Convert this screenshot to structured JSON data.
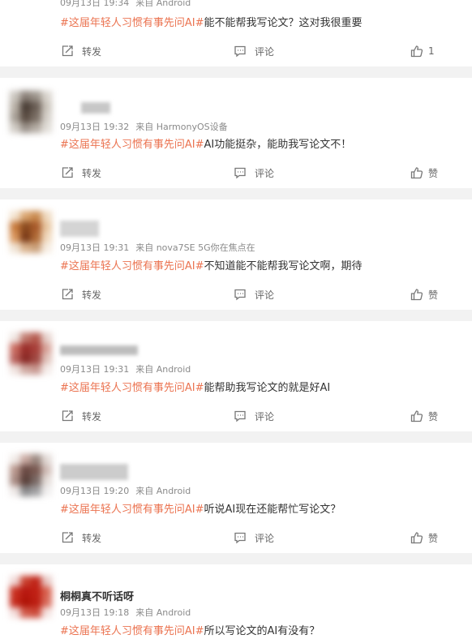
{
  "posts": [
    {
      "meta_time": "09月13日 19:34",
      "meta_source": "来自 Android",
      "topic": "#这届年轻人习惯有事先问AI#",
      "content": "能不能帮我写论文？这对我很重要",
      "repost_label": "转发",
      "comment_label": "评论",
      "like_label": "1",
      "avatar_colors": [
        "#ffffff"
      ],
      "username_blur_color": "#d0d0d0"
    },
    {
      "meta_time": "09月13日 19:32",
      "meta_source": "来自 HarmonyOS设备",
      "topic": "#这届年轻人习惯有事先问AI#",
      "content": "AI功能挺杂，能助我写论文不！",
      "repost_label": "转发",
      "comment_label": "评论",
      "like_label": "赞",
      "avatar_colors": [
        "#c9c4bd",
        "#8a8078",
        "#9c948b",
        "#d8d3cc",
        "#b8b0a6",
        "#4a3e36",
        "#6a5e55",
        "#cbc5bc",
        "#a8a097",
        "#5a4c42",
        "#7a6e64",
        "#d4cfc8",
        "#cfcac3",
        "#9a9189",
        "#b2aaa1",
        "#e0dcd6"
      ],
      "username_blur_color": "#c7c7c7"
    },
    {
      "meta_time": "09月13日 19:31",
      "meta_source": "来自 nova7SE 5G你在焦点在",
      "topic": "#这届年轻人习惯有事先问AI#",
      "content": "不知道能不能帮我写论文啊，期待",
      "repost_label": "转发",
      "comment_label": "评论",
      "like_label": "赞",
      "avatar_colors": [
        "#f3e3cf",
        "#d9a46e",
        "#c98a4e",
        "#efd9bf",
        "#c77a3c",
        "#8a4a1e",
        "#a85a2a",
        "#e8c6a0",
        "#d8955a",
        "#7a3a18",
        "#b06a36",
        "#f0d8bc",
        "#efe2d2",
        "#d8b08a",
        "#caa07a",
        "#f6ece0"
      ],
      "username_blur_color": "#d4d4d4"
    },
    {
      "meta_time": "09月13日 19:31",
      "meta_source": "来自 Android",
      "topic": "#这届年轻人习惯有事先问AI#",
      "content": "能帮助我写论文的就是好AI",
      "repost_label": "转发",
      "comment_label": "评论",
      "like_label": "赞",
      "avatar_colors": [
        "#efe6e2",
        "#c07a6e",
        "#b55a4e",
        "#e6d2cc",
        "#c86a5e",
        "#9a2e2a",
        "#a8403a",
        "#d8a49a",
        "#b8605a",
        "#8a2a26",
        "#a04842",
        "#e0c2ba",
        "#efe2de",
        "#cfa8a0",
        "#c89890",
        "#f4ebe8"
      ],
      "username_blur_color": "#bdbdbd"
    },
    {
      "meta_time": "09月13日 19:20",
      "meta_source": "来自 Android",
      "topic": "#这届年轻人习惯有事先问AI#",
      "content": "听说AI现在还能帮忙写论文？",
      "repost_label": "转发",
      "comment_label": "评论",
      "like_label": "赞",
      "avatar_colors": [
        "#f1ebe8",
        "#c8a8a0",
        "#9a8880",
        "#e2dad6",
        "#b8968c",
        "#6a4a44",
        "#7a5a52",
        "#d0bcb6",
        "#a88a82",
        "#5a403a",
        "#7a6a66",
        "#e4dcd8",
        "#ede8e6",
        "#8a8a8c",
        "#a0a0a2",
        "#f0eeee"
      ],
      "username_blur_color": "#cccccc"
    },
    {
      "username": "桐桐真不听话呀",
      "meta_time": "09月13日 19:18",
      "meta_source": "来自 Android",
      "topic": "#这届年轻人习惯有事先问AI#",
      "content": "所以写论文的AI有没有？",
      "avatar_colors": [
        "#f0d8d6",
        "#c8402e",
        "#c02418",
        "#e8c8c4",
        "#c83020",
        "#b81810",
        "#c02014",
        "#d8604e",
        "#c42a1c",
        "#b01408",
        "#bc1e12",
        "#d86a5a",
        "#f2dcda",
        "#d05848",
        "#cc4a3a",
        "#f4e2e0"
      ]
    }
  ]
}
